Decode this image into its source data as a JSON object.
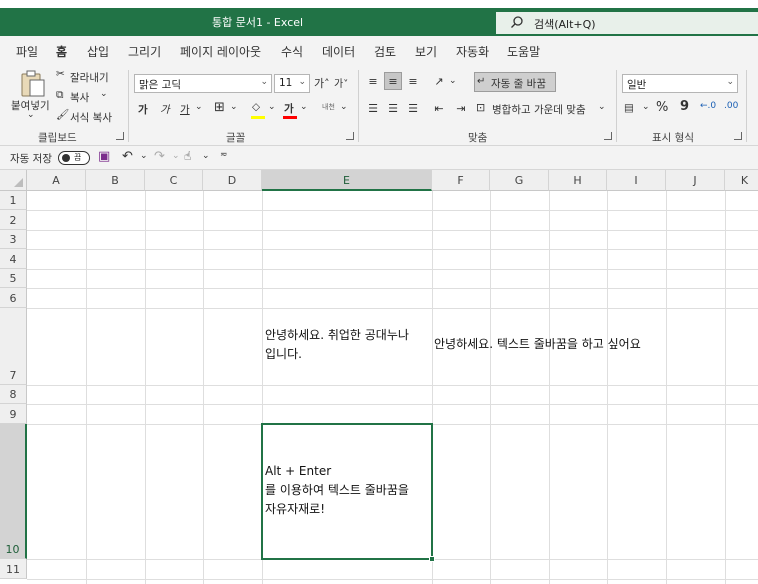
{
  "window": {
    "title": "통합 문서1  -  Excel",
    "search": "검색(Alt+Q)"
  },
  "tabs": [
    "파일",
    "홈",
    "삽입",
    "그리기",
    "페이지 레이아웃",
    "수식",
    "데이터",
    "검토",
    "보기",
    "자동화",
    "도움말"
  ],
  "ribbon": {
    "clipboard": {
      "paste": "붙여넣기",
      "cut": "잘라내기",
      "copy": "복사",
      "format_painter": "서식 복사",
      "label": "클립보드"
    },
    "font": {
      "name": "맑은 고딕",
      "size": "11",
      "label": "글꼴",
      "bold": "가",
      "italic": "가",
      "underline": "가",
      "font_color_glyph": "가",
      "phonetic": "내천"
    },
    "alignment": {
      "wrap_text": "자동 줄 바꿈",
      "merge_center": "병합하고 가운데 맞춤",
      "label": "맞춤"
    },
    "number": {
      "format": "일반",
      "label": "표시 형식",
      "percent": "%",
      "comma": "9"
    }
  },
  "qat": {
    "autosave": "자동 저장",
    "toggle": "끔"
  },
  "columns": [
    "A",
    "B",
    "C",
    "D",
    "E",
    "F",
    "G",
    "H",
    "I",
    "J",
    "K"
  ],
  "rows": [
    "1",
    "2",
    "3",
    "4",
    "5",
    "6",
    "7",
    "8",
    "9",
    "10",
    "11"
  ],
  "cells": {
    "E7": [
      "안녕하세요. 취업한 공대누나",
      "입니다."
    ],
    "F7": "안녕하세요. 텍스트 줄바꿈을 하고 싶어요",
    "E10": [
      "Alt + Enter",
      "를 이용하여 텍스트 줄바꿈을",
      "자유자재로!"
    ]
  }
}
